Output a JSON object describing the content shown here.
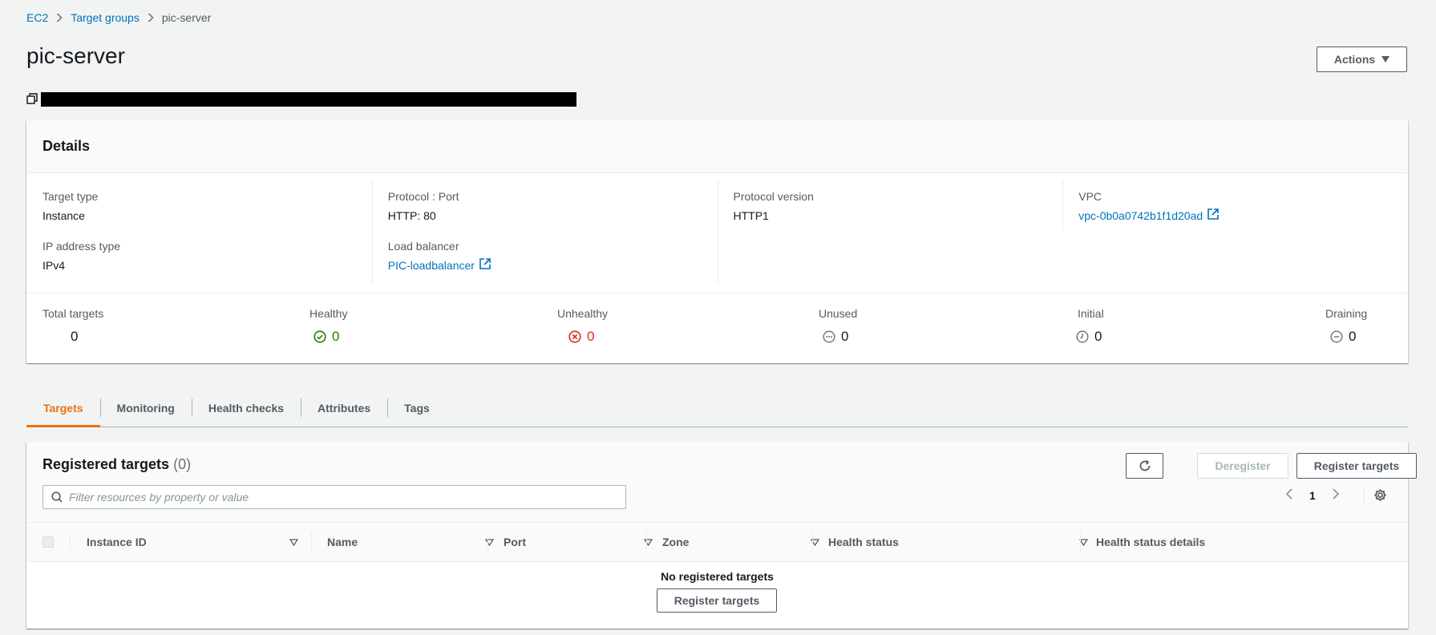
{
  "breadcrumb": {
    "items": [
      "EC2",
      "Target groups"
    ],
    "current": "pic-server"
  },
  "page": {
    "title": "pic-server",
    "actions_label": "Actions"
  },
  "details": {
    "heading": "Details",
    "target_type": {
      "label": "Target type",
      "value": "Instance"
    },
    "ip_address_type": {
      "label": "IP address type",
      "value": "IPv4"
    },
    "protocol_port": {
      "label": "Protocol : Port",
      "value": "HTTP: 80"
    },
    "load_balancer": {
      "label": "Load balancer",
      "value": "PIC-loadbalancer"
    },
    "protocol_version": {
      "label": "Protocol version",
      "value": "HTTP1"
    },
    "vpc": {
      "label": "VPC",
      "value": "vpc-0b0a0742b1f1d20ad"
    }
  },
  "stats": {
    "total": {
      "label": "Total targets",
      "value": "0"
    },
    "healthy": {
      "label": "Healthy",
      "value": "0"
    },
    "unhealthy": {
      "label": "Unhealthy",
      "value": "0"
    },
    "unused": {
      "label": "Unused",
      "value": "0"
    },
    "initial": {
      "label": "Initial",
      "value": "0"
    },
    "draining": {
      "label": "Draining",
      "value": "0"
    }
  },
  "tabs": [
    "Targets",
    "Monitoring",
    "Health checks",
    "Attributes",
    "Tags"
  ],
  "active_tab": "Targets",
  "targets": {
    "title": "Registered targets",
    "count": "(0)",
    "deregister_label": "Deregister",
    "register_label": "Register targets",
    "search_placeholder": "Filter resources by property or value",
    "page_number": "1",
    "columns": [
      "Instance ID",
      "Name",
      "Port",
      "Zone",
      "Health status",
      "Health status details"
    ],
    "empty_message": "No registered targets",
    "empty_register_label": "Register targets"
  },
  "colors": {
    "link": "#0073bb",
    "active_tab": "#ec7211",
    "healthy": "#1d8102",
    "unhealthy": "#d13212"
  }
}
